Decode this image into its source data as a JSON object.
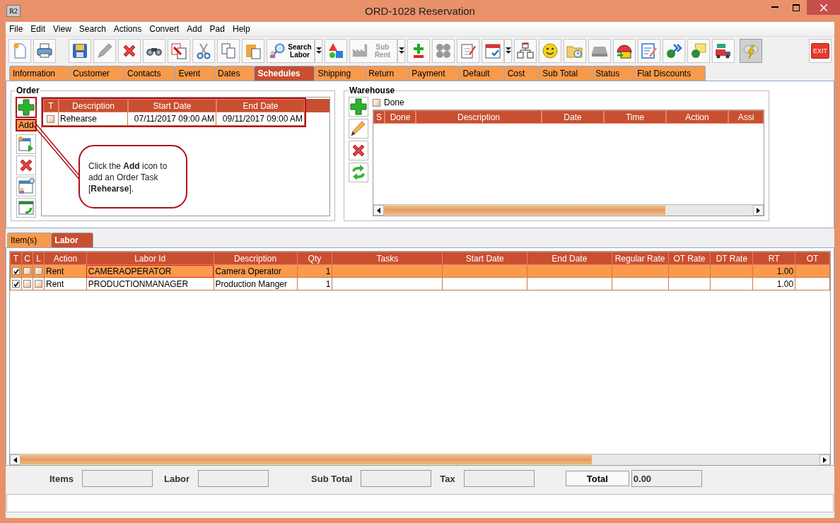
{
  "window": {
    "title": "ORD-1028 Reservation",
    "app_icon_text": "R2"
  },
  "menu": [
    "File",
    "Edit",
    "View",
    "Search",
    "Actions",
    "Convert",
    "Add",
    "Pad",
    "Help"
  ],
  "toolbar": {
    "search_labor": {
      "label": "Search Labor",
      "disabled": false
    },
    "sub_rent": {
      "label": "Sub Rent",
      "disabled": true
    },
    "exit": "EXIT"
  },
  "tabs": [
    {
      "label": "Information",
      "selected": false
    },
    {
      "label": "Customer",
      "selected": false
    },
    {
      "label": "Contacts",
      "selected": false
    },
    {
      "label": "Event",
      "selected": false
    },
    {
      "label": "Dates",
      "selected": false
    },
    {
      "label": "Schedules",
      "selected": true
    },
    {
      "label": "Shipping",
      "selected": false
    },
    {
      "label": "Return",
      "selected": false
    },
    {
      "label": "Payment",
      "selected": false
    },
    {
      "label": "Default",
      "selected": false
    },
    {
      "label": "Cost",
      "selected": false
    },
    {
      "label": "Sub Total",
      "selected": false
    },
    {
      "label": "Status",
      "selected": false
    },
    {
      "label": "Flat Discounts",
      "selected": false
    }
  ],
  "order": {
    "title": "Order",
    "add_tooltip": "Add",
    "columns": [
      "T",
      "Description",
      "Start Date",
      "End Date"
    ],
    "rows": [
      {
        "checked": false,
        "description": "Rehearse",
        "start_date": "07/11/2017 09:00 AM",
        "end_date": "09/11/2017 09:00 AM"
      }
    ],
    "callout": "Click the **Add** icon to add an Order Task [**Rehearse**]."
  },
  "warehouse": {
    "title": "Warehouse",
    "done_filter": {
      "label": "Done",
      "checked": false
    },
    "columns": [
      "S",
      "Done",
      "Description",
      "Date",
      "Time",
      "Action",
      "Assi"
    ]
  },
  "lower_tabs": [
    {
      "label": "Item(s)",
      "selected": false
    },
    {
      "label": "Labor",
      "selected": true
    }
  ],
  "labor_table": {
    "columns": [
      "T",
      "C",
      "L",
      "Action",
      "Labor Id",
      "Description",
      "Qty",
      "Tasks",
      "Start Date",
      "End Date",
      "Regular Rate",
      "OT Rate",
      "DT Rate",
      "RT",
      "OT"
    ],
    "rows": [
      {
        "selected": true,
        "t": true,
        "c": false,
        "l": false,
        "action": "Rent",
        "labor_id": "CAMERAOPERATOR",
        "description": "Camera Operator",
        "qty": "1",
        "rt": "1.00"
      },
      {
        "selected": false,
        "t": true,
        "c": false,
        "l": false,
        "action": "Rent",
        "labor_id": "PRODUCTIONMANAGER",
        "description": "Production Manger",
        "qty": "1",
        "rt": "1.00"
      }
    ]
  },
  "totals": {
    "items_label": "Items",
    "labor_label": "Labor",
    "sub_total_label": "Sub Total",
    "tax_label": "Tax",
    "total_button": "Total",
    "total_value": "0.00"
  }
}
